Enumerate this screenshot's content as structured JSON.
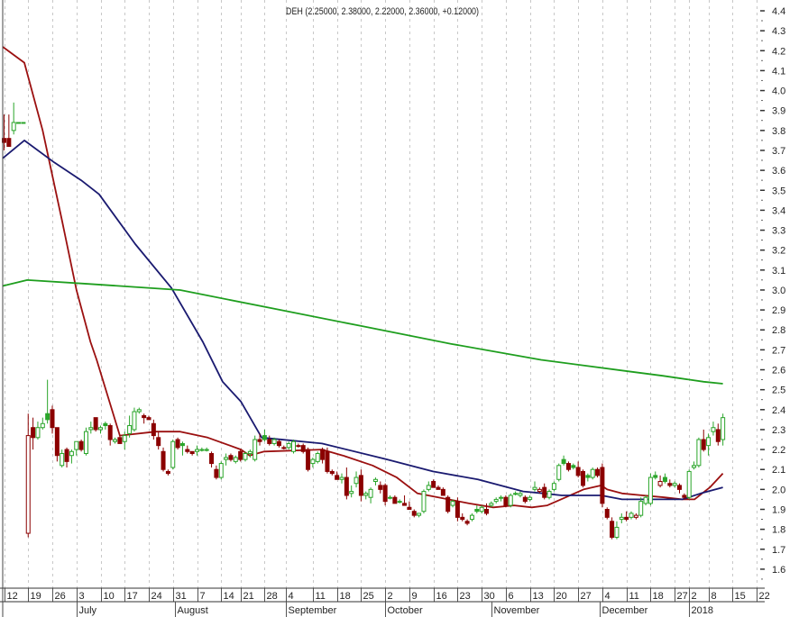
{
  "chart_data": {
    "type": "candlestick",
    "title": "DEH (2.25000, 2.38000, 2.22000, 2.36000, +0.12000)",
    "ylim": [
      1.55,
      4.45
    ],
    "yticks": [
      "4.4",
      "4.3",
      "4.2",
      "4.1",
      "4.0",
      "3.9",
      "3.8",
      "3.7",
      "3.6",
      "3.5",
      "3.4",
      "3.3",
      "3.2",
      "3.1",
      "3.0",
      "2.9",
      "2.8",
      "2.7",
      "2.6",
      "2.5",
      "2.4",
      "2.3",
      "2.2",
      "2.1",
      "2.0",
      "1.9",
      "1.8",
      "1.7",
      "1.6"
    ],
    "ytick_values": [
      4.4,
      4.3,
      4.2,
      4.1,
      4.0,
      3.9,
      3.8,
      3.7,
      3.6,
      3.5,
      3.4,
      3.3,
      3.2,
      3.1,
      3.0,
      2.9,
      2.8,
      2.7,
      2.6,
      2.5,
      2.4,
      2.3,
      2.2,
      2.1,
      2.0,
      1.9,
      1.8,
      1.7,
      1.6
    ],
    "xticks": [
      {
        "label": "12",
        "day": 0
      },
      {
        "label": "19",
        "day": 5
      },
      {
        "label": "26",
        "day": 10
      },
      {
        "label": "3",
        "day": 15
      },
      {
        "label": "10",
        "day": 20
      },
      {
        "label": "17",
        "day": 25
      },
      {
        "label": "24",
        "day": 30
      },
      {
        "label": "31",
        "day": 35
      },
      {
        "label": "7",
        "day": 40
      },
      {
        "label": "14",
        "day": 45
      },
      {
        "label": "21",
        "day": 49
      },
      {
        "label": "28",
        "day": 54
      },
      {
        "label": "4",
        "day": 58.5
      },
      {
        "label": "11",
        "day": 64
      },
      {
        "label": "18",
        "day": 69
      },
      {
        "label": "25",
        "day": 74
      },
      {
        "label": "2",
        "day": 79
      },
      {
        "label": "9",
        "day": 84
      },
      {
        "label": "16",
        "day": 89
      },
      {
        "label": "23",
        "day": 94
      },
      {
        "label": "30",
        "day": 99
      },
      {
        "label": "6",
        "day": 104
      },
      {
        "label": "13",
        "day": 109
      },
      {
        "label": "20",
        "day": 114
      },
      {
        "label": "27",
        "day": 119
      },
      {
        "label": "4",
        "day": 124
      },
      {
        "label": "11",
        "day": 129
      },
      {
        "label": "18",
        "day": 134
      },
      {
        "label": "27",
        "day": 139
      },
      {
        "label": "2",
        "day": 142
      },
      {
        "label": "8",
        "day": 146
      },
      {
        "label": "15",
        "day": 151
      },
      {
        "label": "22",
        "day": 156
      }
    ],
    "months": [
      {
        "label": "July",
        "day": 15
      },
      {
        "label": "August",
        "day": 35.5
      },
      {
        "label": "September",
        "day": 58.5
      },
      {
        "label": "October",
        "day": 79
      },
      {
        "label": "November",
        "day": 101
      },
      {
        "label": "December",
        "day": 123.5
      },
      {
        "label": "2018",
        "day": 142
      }
    ],
    "candles_ohlc": [
      [
        3.76,
        3.88,
        3.7,
        3.74
      ],
      [
        3.76,
        3.88,
        3.72,
        3.72
      ],
      [
        3.8,
        3.94,
        3.78,
        3.84
      ],
      [
        3.84,
        3.84,
        3.84,
        3.84
      ],
      [
        3.84,
        3.84,
        3.84,
        3.84
      ],
      [
        1.78,
        2.38,
        1.76,
        2.27
      ],
      [
        2.31,
        2.36,
        2.2,
        2.26
      ],
      [
        2.26,
        2.34,
        2.25,
        2.31
      ],
      [
        2.31,
        2.36,
        2.3,
        2.33
      ],
      [
        2.38,
        2.55,
        2.33,
        2.35
      ],
      [
        2.4,
        2.42,
        2.28,
        2.31
      ],
      [
        2.31,
        2.31,
        2.14,
        2.17
      ],
      [
        2.12,
        2.2,
        2.11,
        2.18
      ],
      [
        2.2,
        2.21,
        2.11,
        2.14
      ],
      [
        2.17,
        2.2,
        2.13,
        2.19
      ],
      [
        2.2,
        2.24,
        2.17,
        2.24
      ],
      [
        2.24,
        2.25,
        2.19,
        2.2
      ],
      [
        2.18,
        2.31,
        2.17,
        2.29
      ],
      [
        2.3,
        2.34,
        2.28,
        2.31
      ],
      [
        2.36,
        2.36,
        2.29,
        2.3
      ],
      [
        2.3,
        2.32,
        2.28,
        2.31
      ],
      [
        2.33,
        2.34,
        2.3,
        2.32
      ],
      [
        2.32,
        2.33,
        2.22,
        2.25
      ],
      [
        2.24,
        2.26,
        2.23,
        2.25
      ],
      [
        2.26,
        2.27,
        2.23,
        2.23
      ],
      [
        2.24,
        2.29,
        2.2,
        2.27
      ],
      [
        2.28,
        2.37,
        2.26,
        2.32
      ],
      [
        2.3,
        2.41,
        2.29,
        2.39
      ],
      [
        2.39,
        2.41,
        2.38,
        2.4
      ],
      [
        2.37,
        2.38,
        2.33,
        2.36
      ],
      [
        2.36,
        2.37,
        2.35,
        2.35
      ],
      [
        2.33,
        2.35,
        2.25,
        2.27
      ],
      [
        2.26,
        2.29,
        2.2,
        2.22
      ],
      [
        2.19,
        2.21,
        2.09,
        2.1
      ],
      [
        2.09,
        2.1,
        2.07,
        2.08
      ],
      [
        2.11,
        2.25,
        2.1,
        2.24
      ],
      [
        2.25,
        2.26,
        2.2,
        2.21
      ],
      [
        2.23,
        2.24,
        2.17,
        2.22
      ],
      [
        2.2,
        2.22,
        2.18,
        2.19
      ],
      [
        2.19,
        2.19,
        2.17,
        2.18
      ],
      [
        2.19,
        2.22,
        2.17,
        2.2
      ],
      [
        2.2,
        2.21,
        2.19,
        2.2
      ],
      [
        2.2,
        2.21,
        2.19,
        2.2
      ],
      [
        2.18,
        2.19,
        2.11,
        2.13
      ],
      [
        2.1,
        2.12,
        2.05,
        2.06
      ],
      [
        2.06,
        2.14,
        2.05,
        2.13
      ],
      [
        2.15,
        2.18,
        2.12,
        2.16
      ],
      [
        2.17,
        2.18,
        2.14,
        2.15
      ],
      [
        2.14,
        2.17,
        2.13,
        2.16
      ],
      [
        2.19,
        2.2,
        2.14,
        2.15
      ],
      [
        2.15,
        2.19,
        2.14,
        2.18
      ],
      [
        2.18,
        2.2,
        2.16,
        2.19
      ],
      [
        2.15,
        2.27,
        2.14,
        2.25
      ],
      [
        2.25,
        2.28,
        2.22,
        2.24
      ],
      [
        2.27,
        2.3,
        2.24,
        2.25
      ],
      [
        2.25,
        2.27,
        2.22,
        2.23
      ],
      [
        2.23,
        2.26,
        2.22,
        2.25
      ],
      [
        2.24,
        2.25,
        2.21,
        2.22
      ],
      [
        2.21,
        2.22,
        2.2,
        2.21
      ],
      [
        2.21,
        2.24,
        2.2,
        2.23
      ],
      [
        2.19,
        2.25,
        2.18,
        2.24
      ],
      [
        2.22,
        2.23,
        2.21,
        2.22
      ],
      [
        2.22,
        2.23,
        2.18,
        2.19
      ],
      [
        2.2,
        2.21,
        2.09,
        2.1
      ],
      [
        2.13,
        2.16,
        2.11,
        2.15
      ],
      [
        2.14,
        2.19,
        2.13,
        2.18
      ],
      [
        2.2,
        2.21,
        2.13,
        2.15
      ],
      [
        2.19,
        2.21,
        2.08,
        2.09
      ],
      [
        2.09,
        2.1,
        2.07,
        2.08
      ],
      [
        2.07,
        2.09,
        2.05,
        2.05
      ],
      [
        2.05,
        2.08,
        2.03,
        2.06
      ],
      [
        2.06,
        2.11,
        1.95,
        1.97
      ],
      [
        1.98,
        2.02,
        1.96,
        1.99
      ],
      [
        2.03,
        2.09,
        2.01,
        2.06
      ],
      [
        2.07,
        2.1,
        1.94,
        1.97
      ],
      [
        1.97,
        1.99,
        1.95,
        1.98
      ],
      [
        1.96,
        2.01,
        1.93,
        2.0
      ],
      [
        2.04,
        2.06,
        2.02,
        2.05
      ],
      [
        2.02,
        2.04,
        1.98,
        2.0
      ],
      [
        2.02,
        2.03,
        1.92,
        1.94
      ],
      [
        1.96,
        1.97,
        1.95,
        1.96
      ],
      [
        1.96,
        1.97,
        1.93,
        1.93
      ],
      [
        1.94,
        1.95,
        1.93,
        1.94
      ],
      [
        1.93,
        1.97,
        1.92,
        1.92
      ],
      [
        1.91,
        1.94,
        1.9,
        1.9
      ],
      [
        1.89,
        1.9,
        1.86,
        1.87
      ],
      [
        1.87,
        1.88,
        1.86,
        1.88
      ],
      [
        1.89,
        2.0,
        1.88,
        1.99
      ],
      [
        2.0,
        2.04,
        1.99,
        2.02
      ],
      [
        2.04,
        2.05,
        2.01,
        2.01
      ],
      [
        2.01,
        2.02,
        2.0,
        2.0
      ],
      [
        2.0,
        2.01,
        1.97,
        1.97
      ],
      [
        1.96,
        1.97,
        1.88,
        1.89
      ],
      [
        1.92,
        1.95,
        1.91,
        1.94
      ],
      [
        1.94,
        1.96,
        1.84,
        1.86
      ],
      [
        1.86,
        1.88,
        1.84,
        1.85
      ],
      [
        1.84,
        1.85,
        1.82,
        1.83
      ],
      [
        1.85,
        1.88,
        1.84,
        1.87
      ],
      [
        1.9,
        1.92,
        1.88,
        1.89
      ],
      [
        1.89,
        1.92,
        1.88,
        1.91
      ],
      [
        1.9,
        1.93,
        1.87,
        1.88
      ],
      [
        1.92,
        1.94,
        1.91,
        1.93
      ],
      [
        1.94,
        1.96,
        1.93,
        1.95
      ],
      [
        1.96,
        1.97,
        1.94,
        1.96
      ],
      [
        1.96,
        1.97,
        1.91,
        1.92
      ],
      [
        1.92,
        1.98,
        1.91,
        1.97
      ],
      [
        1.98,
        1.99,
        1.97,
        1.98
      ],
      [
        1.97,
        1.99,
        1.96,
        1.98
      ],
      [
        1.96,
        1.97,
        1.93,
        1.94
      ],
      [
        1.95,
        1.97,
        1.94,
        1.96
      ],
      [
        2.0,
        2.04,
        1.99,
        2.01
      ],
      [
        1.99,
        2.01,
        1.98,
        2.0
      ],
      [
        2.01,
        2.03,
        1.95,
        1.96
      ],
      [
        1.96,
        2.0,
        1.95,
        1.99
      ],
      [
        2.0,
        2.04,
        1.99,
        2.03
      ],
      [
        2.05,
        2.13,
        2.04,
        2.12
      ],
      [
        2.15,
        2.17,
        2.12,
        2.13
      ],
      [
        2.13,
        2.14,
        2.09,
        2.1
      ],
      [
        2.12,
        2.13,
        2.1,
        2.11
      ],
      [
        2.11,
        2.14,
        2.06,
        2.07
      ],
      [
        2.09,
        2.1,
        2.01,
        2.02
      ],
      [
        2.07,
        2.08,
        2.04,
        2.06
      ],
      [
        2.06,
        2.11,
        2.05,
        2.1
      ],
      [
        2.1,
        2.11,
        2.06,
        2.07
      ],
      [
        2.11,
        2.13,
        1.91,
        1.93
      ],
      [
        1.9,
        1.91,
        1.85,
        1.86
      ],
      [
        1.84,
        1.86,
        1.75,
        1.76
      ],
      [
        1.76,
        1.84,
        1.75,
        1.81
      ],
      [
        1.85,
        1.88,
        1.83,
        1.86
      ],
      [
        1.86,
        1.89,
        1.84,
        1.85
      ],
      [
        1.86,
        1.89,
        1.85,
        1.88
      ],
      [
        1.86,
        1.88,
        1.85,
        1.87
      ],
      [
        1.87,
        1.96,
        1.86,
        1.94
      ],
      [
        1.93,
        1.97,
        1.92,
        1.96
      ],
      [
        1.93,
        2.08,
        1.92,
        2.06
      ],
      [
        2.07,
        2.09,
        2.05,
        2.06
      ],
      [
        2.02,
        2.07,
        2.01,
        2.04
      ],
      [
        2.06,
        2.08,
        2.03,
        2.04
      ],
      [
        2.03,
        2.05,
        2.01,
        2.02
      ],
      [
        2.02,
        2.04,
        2.01,
        2.03
      ],
      [
        2.02,
        2.03,
        1.98,
        2.0
      ],
      [
        1.97,
        1.98,
        1.95,
        1.96
      ],
      [
        1.96,
        2.1,
        1.95,
        2.09
      ],
      [
        2.11,
        2.14,
        2.1,
        2.12
      ],
      [
        2.12,
        2.26,
        2.11,
        2.25
      ],
      [
        2.25,
        2.3,
        2.19,
        2.2
      ],
      [
        2.22,
        2.28,
        2.17,
        2.26
      ],
      [
        2.29,
        2.34,
        2.27,
        2.31
      ],
      [
        2.3,
        2.33,
        2.22,
        2.24
      ],
      [
        2.25,
        2.38,
        2.22,
        2.36
      ]
    ],
    "moving_averages": [
      {
        "name": "fast-ma",
        "color": "#9b1010",
        "points": [
          [
            -0.3,
            4.22
          ],
          [
            4.2,
            4.14
          ],
          [
            8,
            3.8
          ],
          [
            12,
            3.35
          ],
          [
            15,
            3.0
          ],
          [
            17.9,
            2.74
          ],
          [
            19.2,
            2.65
          ],
          [
            24,
            2.27
          ],
          [
            31.5,
            2.29
          ],
          [
            36.5,
            2.29
          ],
          [
            42.2,
            2.26
          ],
          [
            49.1,
            2.2
          ],
          [
            50.9,
            2.17
          ],
          [
            53.9,
            2.19
          ],
          [
            65.9,
            2.2
          ],
          [
            70.2,
            2.17
          ],
          [
            76.4,
            2.12
          ],
          [
            81.4,
            2.06
          ],
          [
            85.7,
            1.98
          ],
          [
            92.1,
            1.95
          ],
          [
            96.4,
            1.93
          ],
          [
            101.4,
            1.91
          ],
          [
            105.7,
            1.92
          ],
          [
            109.4,
            1.91
          ],
          [
            112.6,
            1.92
          ],
          [
            116.4,
            1.96
          ],
          [
            120.1,
            2.0
          ],
          [
            123.8,
            2.02
          ],
          [
            125,
            2.0
          ],
          [
            128.1,
            1.98
          ],
          [
            132.4,
            1.97
          ],
          [
            136.9,
            1.96
          ],
          [
            140.6,
            1.95
          ],
          [
            143.1,
            1.95
          ],
          [
            146.3,
            2.01
          ],
          [
            149,
            2.08
          ]
        ]
      },
      {
        "name": "medium-ma",
        "color": "#1a1a70",
        "points": [
          [
            -0.3,
            3.66
          ],
          [
            4.2,
            3.75
          ],
          [
            10.4,
            3.64
          ],
          [
            16,
            3.55
          ],
          [
            19.7,
            3.48
          ],
          [
            27.2,
            3.23
          ],
          [
            34.7,
            3.01
          ],
          [
            41.2,
            2.74
          ],
          [
            45.3,
            2.54
          ],
          [
            49.1,
            2.44
          ],
          [
            53.4,
            2.26
          ],
          [
            65.9,
            2.23
          ],
          [
            79.5,
            2.15
          ],
          [
            88.9,
            2.09
          ],
          [
            98.2,
            2.05
          ],
          [
            107.6,
            1.99
          ],
          [
            111.9,
            1.98
          ],
          [
            115.6,
            1.97
          ],
          [
            123.8,
            1.97
          ],
          [
            128.1,
            1.95
          ],
          [
            133.7,
            1.95
          ],
          [
            140.6,
            1.95
          ],
          [
            144.4,
            1.98
          ],
          [
            149,
            2.01
          ]
        ]
      },
      {
        "name": "slow-ma",
        "color": "#1e9e1e",
        "points": [
          [
            -0.3,
            3.02
          ],
          [
            4.8,
            3.05
          ],
          [
            17.8,
            3.03
          ],
          [
            36.5,
            3.0
          ],
          [
            55.2,
            2.91
          ],
          [
            73.9,
            2.82
          ],
          [
            92.6,
            2.73
          ],
          [
            111.3,
            2.65
          ],
          [
            130,
            2.59
          ],
          [
            136.5,
            2.57
          ],
          [
            145,
            2.54
          ],
          [
            149,
            2.53
          ]
        ]
      }
    ],
    "colors": {
      "up": "#2aa52a",
      "down": "#8b0000",
      "grid": "#c8c8c8"
    }
  }
}
